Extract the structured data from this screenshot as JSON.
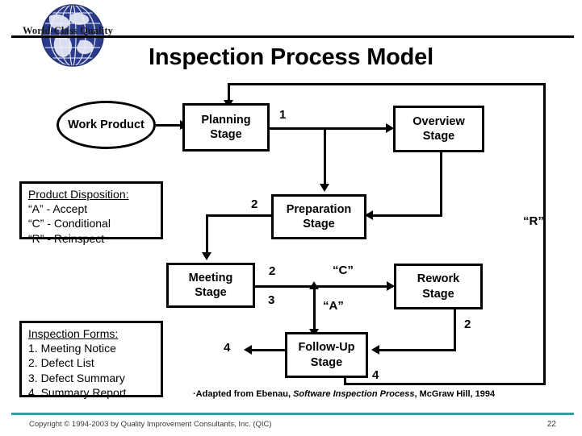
{
  "header": {
    "brand": "World-Class Quality",
    "logo_icon": "globe-icon",
    "title": "Inspection Process Model"
  },
  "diagram": {
    "nodes": [
      {
        "id": "work-product",
        "label": "Work\nProduct",
        "shape": "ellipse"
      },
      {
        "id": "planning-stage",
        "label": "Planning\nStage",
        "shape": "rect"
      },
      {
        "id": "overview-stage",
        "label": "Overview\nStage",
        "shape": "rect"
      },
      {
        "id": "preparation-stage",
        "label": "Preparation\nStage",
        "shape": "rect"
      },
      {
        "id": "meeting-stage",
        "label": "Meeting\nStage",
        "shape": "rect"
      },
      {
        "id": "rework-stage",
        "label": "Rework\nStage",
        "shape": "rect"
      },
      {
        "id": "followup-stage",
        "label": "Follow-Up\nStage",
        "shape": "rect"
      }
    ],
    "edge_labels": {
      "planning_to_overview": "1",
      "preparation_in": "2",
      "meeting_out_top": "2",
      "meeting_out_bottom": "3",
      "conditional": "“C”",
      "accept": "“A”",
      "reinspect": "“R”",
      "rework_out": "2",
      "followup_left": "4",
      "followup_bottom": "4"
    }
  },
  "product_disposition": {
    "heading": "Product Disposition:",
    "rows": [
      "“A” - Accept",
      "“C” - Conditional",
      "“R” - Reinspect"
    ]
  },
  "inspection_forms": {
    "heading": "Inspection Forms:",
    "rows": [
      "1. Meeting Notice",
      "2. Defect List",
      "3. Defect Summary",
      "4. Summary Report"
    ]
  },
  "citation": {
    "prefix": "·Adapted from Ebenau, ",
    "italic": "Software Inspection Process",
    "suffix": ", McGraw Hill, 1994"
  },
  "footer": {
    "copyright": "Copyright © 1994-2003 by Quality Improvement Consultants, Inc. (QIC)",
    "page_number": "22",
    "rule_color": "#33a0a0"
  }
}
